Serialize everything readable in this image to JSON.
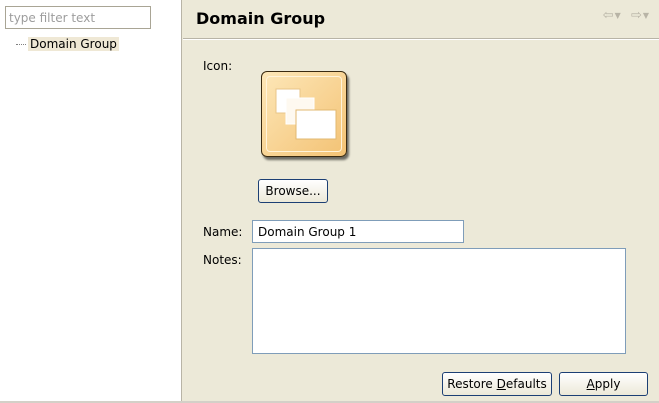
{
  "filter": {
    "placeholder": "type filter text"
  },
  "tree": {
    "items": [
      {
        "label": "Domain Group"
      }
    ]
  },
  "page": {
    "title": "Domain Group"
  },
  "nav": {
    "back_icon": "back-arrow-icon",
    "forward_icon": "forward-arrow-icon"
  },
  "form": {
    "icon_label": "Icon:",
    "browse_label": "Browse...",
    "name_label": "Name:",
    "name_value": "Domain Group 1",
    "notes_label": "Notes:",
    "notes_value": ""
  },
  "buttons": {
    "restore_prefix": "Restore ",
    "restore_mnemonic": "D",
    "restore_suffix": "efaults",
    "apply_mnemonic": "A",
    "apply_suffix": "pply"
  },
  "colors": {
    "background": "#ece9d8",
    "icon_fill": "#f3c274",
    "button_border": "#1c3f74"
  }
}
